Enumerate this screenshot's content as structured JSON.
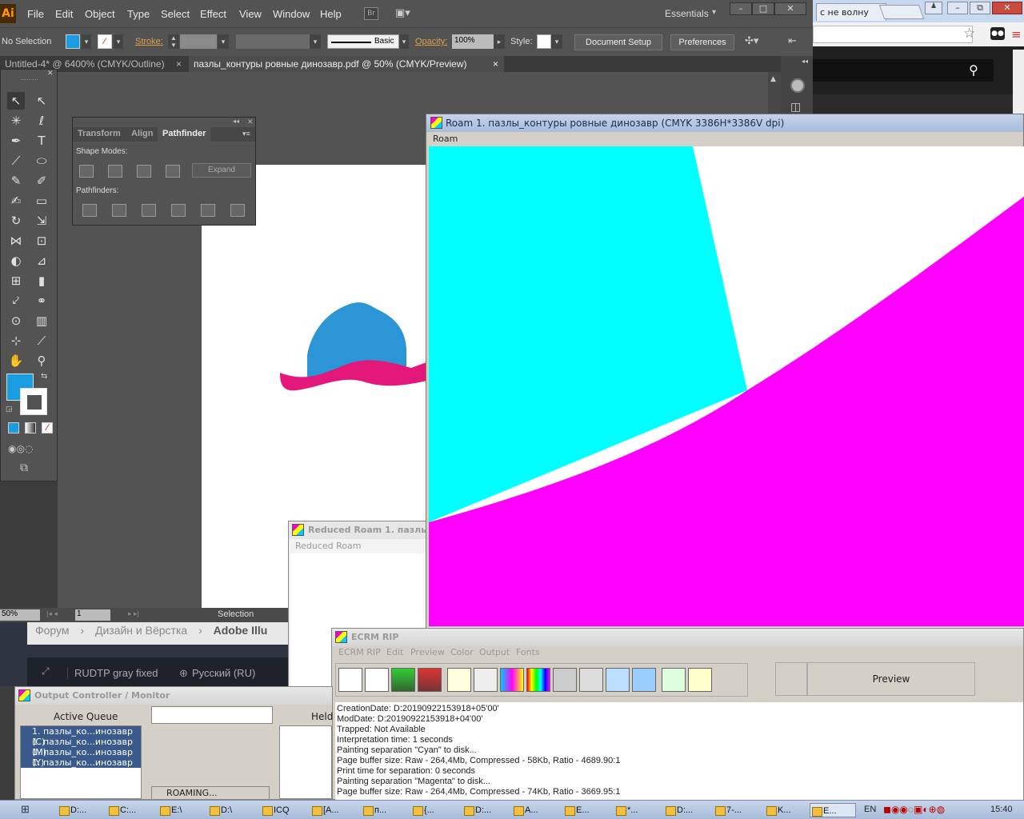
{
  "illustrator": {
    "logo": "Ai",
    "menus": [
      "File",
      "Edit",
      "Object",
      "Type",
      "Select",
      "Effect",
      "View",
      "Window",
      "Help"
    ],
    "br_badge": "Br",
    "workspace": "Essentials",
    "control": {
      "selection": "No Selection",
      "stroke_label": "Stroke:",
      "brush": "Basic",
      "opacity_label": "Opacity:",
      "opacity_value": "100%",
      "style_label": "Style:",
      "document_setup": "Document Setup",
      "preferences": "Preferences"
    },
    "tabs": [
      "Untitled-4* @ 6400% (CMYK/Outline)",
      "пазлы_контуры ровные динозавр.pdf @ 50% (CMYK/Preview)"
    ],
    "pathfinder": {
      "tabs": [
        "Transform",
        "Align",
        "Pathfinder"
      ],
      "shape_modes": "Shape Modes:",
      "expand": "Expand",
      "pathfinders": "Pathfinders:"
    },
    "status": {
      "zoom": "50%",
      "page": "1",
      "tool": "Selection"
    },
    "fill_color": "#1a9de0",
    "art_colors": {
      "blue": "#2b95d6",
      "magenta": "#e3187a"
    }
  },
  "browser": {
    "tab_text": "с не волну",
    "menu_icon": "hamburger-icon"
  },
  "forum": {
    "breadcrumb": [
      "Форум",
      "Дизайн и Вёрстка",
      "Adobe Illu"
    ],
    "theme": "RUDTP gray fixed",
    "language": "Русский (RU)"
  },
  "roam": {
    "title": "Roam 1. пазлы_контуры ровные динозавр  (CMYK 3386H*3386V dpi)",
    "menu": "Roam",
    "colors": {
      "cyan": "#00ffff",
      "magenta": "#ff00ff"
    }
  },
  "reduced_roam": {
    "title": "Reduced Roam 1. пазлы_",
    "menu": "Reduced Roam"
  },
  "output_controller": {
    "title": "Output Controller / Monitor",
    "active_queue": "Active Queue",
    "held": "Held",
    "queue": [
      "1. пазлы_ко...инозавр (C)",
      "1. пазлы_ко...инозавр (M)",
      "1. пазлы_ко...инозавр (Y)",
      "1. пазлы_ко...инозавр (K)"
    ],
    "status": "ROAMING..."
  },
  "ecrm": {
    "title": "ECRM RIP",
    "menus": [
      "ECRM RIP",
      "Edit",
      "Preview",
      "Color",
      "Output",
      "Fonts"
    ],
    "preview_button": "Preview",
    "log": [
      "CreationDate: D:20190922153918+05'00'",
      "ModDate: D:20190922153918+04'00'",
      "Trapped: Not Available",
      "Interpretation time: 1 seconds",
      "Painting separation \"Cyan\" to disk...",
      "Page buffer size: Raw - 264,4Mb, Compressed - 58Kb, Ratio - 4689.90:1",
      "Print time for separation: 0 seconds",
      "Painting separation \"Magenta\" to disk...",
      "Page buffer size: Raw - 264,4Mb, Compressed - 74Kb, Ratio - 3669.95:1"
    ]
  },
  "taskbar": {
    "items": [
      "D:...",
      "C:...",
      "E:\\",
      "D:\\",
      "ICQ",
      "[A...",
      "п...",
      "{...",
      "D:...",
      "A...",
      "E...",
      "*...",
      "D:...",
      "7-...",
      "K...",
      "E..."
    ],
    "lang": "EN",
    "clock": "15:40"
  }
}
